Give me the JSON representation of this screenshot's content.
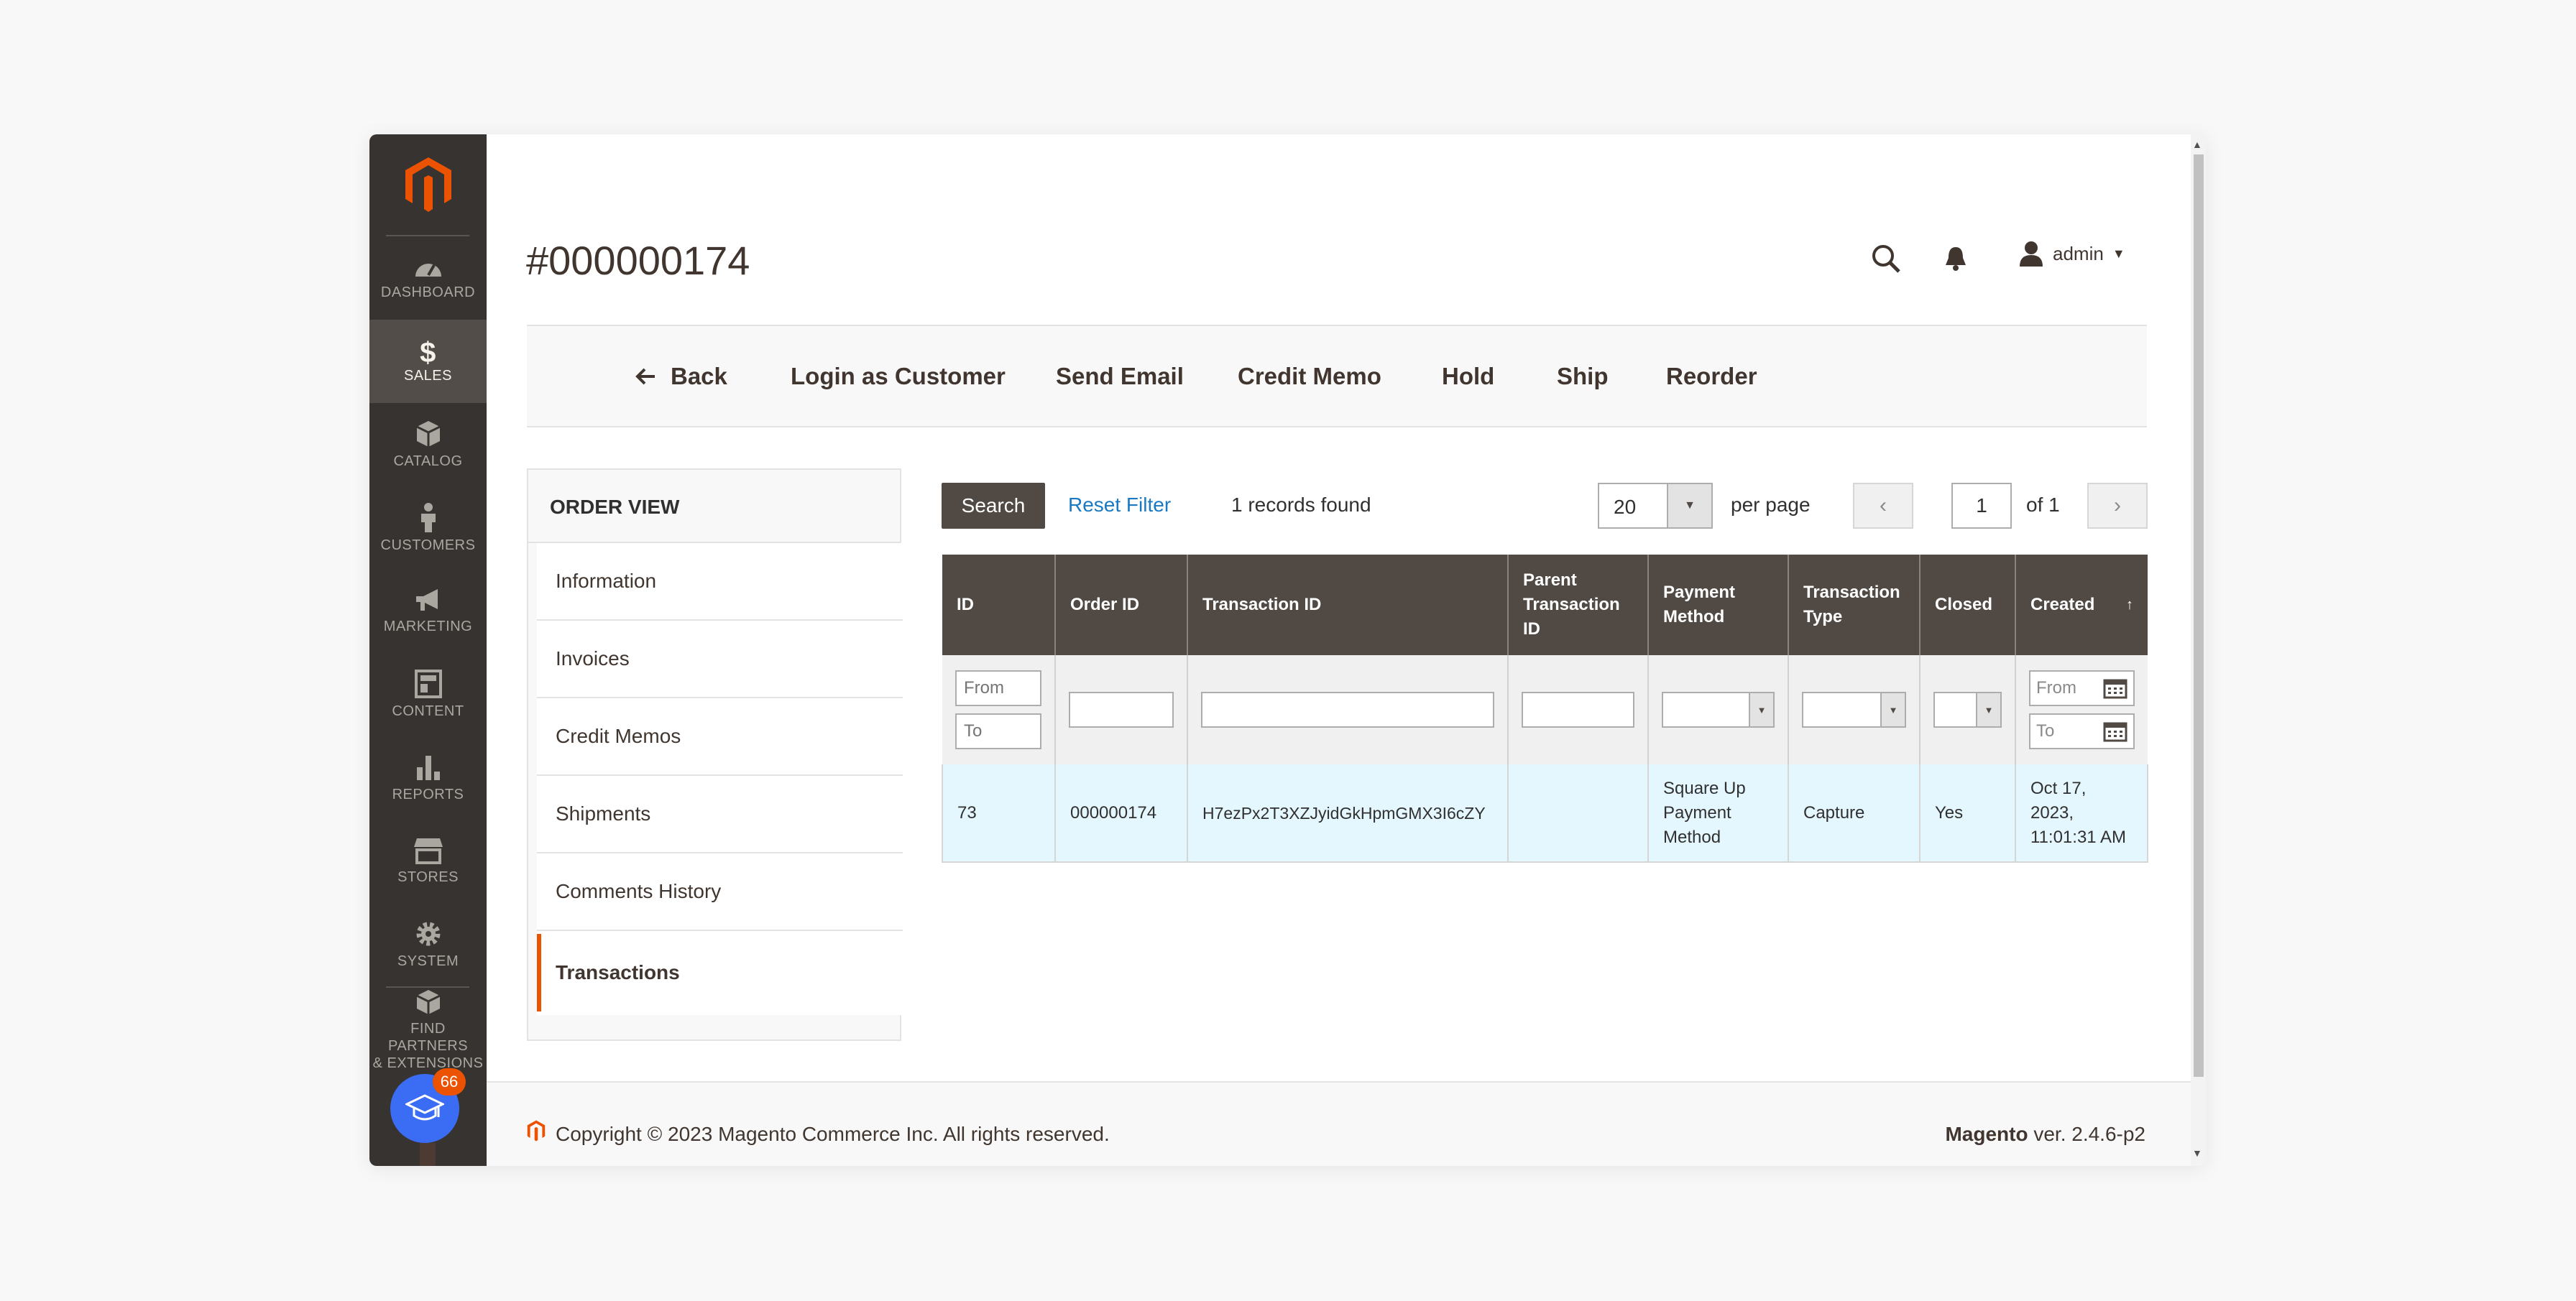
{
  "sidebar": {
    "items": [
      {
        "label": "DASHBOARD",
        "icon": "dashboard-icon"
      },
      {
        "label": "SALES",
        "icon": "dollar-icon"
      },
      {
        "label": "CATALOG",
        "icon": "box-icon"
      },
      {
        "label": "CUSTOMERS",
        "icon": "person-icon"
      },
      {
        "label": "MARKETING",
        "icon": "megaphone-icon"
      },
      {
        "label": "CONTENT",
        "icon": "layout-icon"
      },
      {
        "label": "REPORTS",
        "icon": "bar-chart-icon"
      },
      {
        "label": "STORES",
        "icon": "storefront-icon"
      },
      {
        "label": "SYSTEM",
        "icon": "gear-icon"
      }
    ],
    "partners_line1": "FIND PARTNERS",
    "partners_line2": "& EXTENSIONS",
    "badge_count": "66",
    "brand_color": "#eb5202"
  },
  "header": {
    "title": "#000000174",
    "user": "admin"
  },
  "actions": {
    "back": "Back",
    "login_as_customer": "Login as Customer",
    "send_email": "Send Email",
    "credit_memo": "Credit Memo",
    "hold": "Hold",
    "ship": "Ship",
    "reorder": "Reorder"
  },
  "order_view": {
    "title": "ORDER VIEW",
    "tabs": [
      "Information",
      "Invoices",
      "Credit Memos",
      "Shipments",
      "Comments History",
      "Transactions"
    ],
    "active_tab": "Transactions"
  },
  "grid": {
    "search_label": "Search",
    "reset_label": "Reset Filter",
    "records_found": "1 records found",
    "per_page_value": "20",
    "per_page_label": "per page",
    "page_current": "1",
    "page_of": "of 1",
    "columns": {
      "id": "ID",
      "order_id": "Order ID",
      "transaction_id": "Transaction ID",
      "parent_l1": "Parent",
      "parent_l2": "Transaction",
      "parent_l3": "ID",
      "payment_l1": "Payment",
      "payment_l2": "Method",
      "type_l1": "Transaction",
      "type_l2": "Type",
      "closed": "Closed",
      "created": "Created"
    },
    "filters": {
      "from_placeholder": "From",
      "to_placeholder": "To"
    },
    "row": {
      "id": "73",
      "order_id": "000000174",
      "transaction_id": "H7ezPx2T3XZJyidGkHpmGMX3I6cZY",
      "parent_transaction_id": "",
      "payment_l1": "Square Up",
      "payment_l2": "Payment",
      "payment_l3": "Method",
      "type": "Capture",
      "closed": "Yes",
      "created_l1": "Oct 17,",
      "created_l2": "2023,",
      "created_l3": "11:01:31 AM"
    }
  },
  "footer": {
    "copyright": "Copyright © 2023 Magento Commerce Inc. All rights reserved.",
    "brand": "Magento",
    "version": " ver. 2.4.6-p2"
  }
}
